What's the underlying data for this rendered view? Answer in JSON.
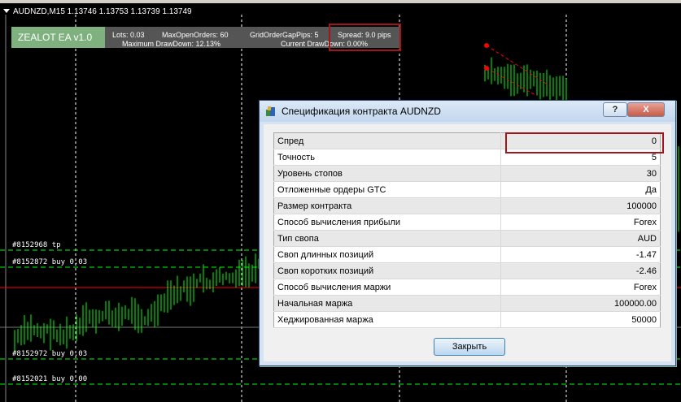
{
  "chart": {
    "symbol_line": "AUDNZD,M15  1.13746 1.13753 1.13739 1.13749",
    "bar_color": "#00ff00",
    "bg_color": "#000000",
    "sl_line_color": "#ff0000",
    "orders": [
      {
        "label": "#8152968 tp"
      },
      {
        "label": "#8152872 buy 0.03"
      },
      {
        "label": "#8152972 buy 0.03"
      },
      {
        "label": "#8152021 buy 0.00"
      }
    ]
  },
  "ea": {
    "name": "ZEALOT EA v1.0",
    "lots": "Lots: 0.03",
    "max_open_orders": "MaxOpenOrders: 60",
    "grid_gap": "GridOrderGapPips: 5",
    "spread": "Spread: 9.0 pips",
    "max_drawdown": "Maximum DrawDown: 12.13%",
    "current_drawdown": "Current DrawDown: 0.00%"
  },
  "dialog": {
    "title": "Спецификация контракта AUDNZD",
    "help_label": "?",
    "close_x": "X",
    "rows": [
      {
        "key": "Спред",
        "value": "0"
      },
      {
        "key": "Точность",
        "value": "5"
      },
      {
        "key": "Уровень стопов",
        "value": "30"
      },
      {
        "key": "Отложенные ордеры GTC",
        "value": "Да"
      },
      {
        "key": "Размер контракта",
        "value": "100000"
      },
      {
        "key": "Способ вычисления прибыли",
        "value": "Forex"
      },
      {
        "key": "Тип свопа",
        "value": "AUD"
      },
      {
        "key": "Своп длинных позиций",
        "value": "-1.47"
      },
      {
        "key": "Своп коротких позиций",
        "value": "-2.46"
      },
      {
        "key": "Способ вычисления маржи",
        "value": "Forex"
      },
      {
        "key": "Начальная маржа",
        "value": "100000.00"
      },
      {
        "key": "Хеджированная маржа",
        "value": "50000"
      }
    ],
    "close_button": "Закрыть"
  }
}
